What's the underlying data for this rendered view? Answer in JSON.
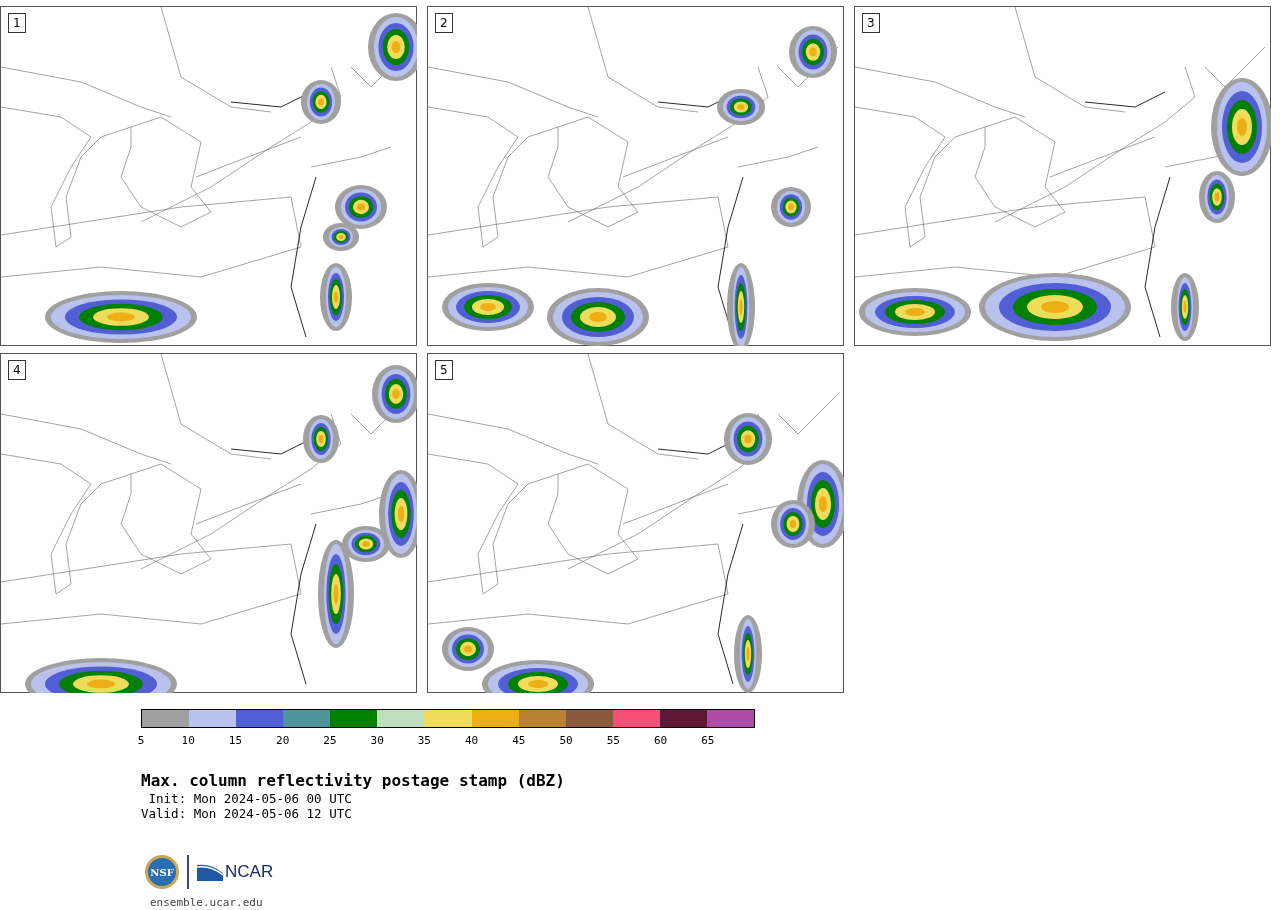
{
  "panels": [
    {
      "label": "1"
    },
    {
      "label": "2"
    },
    {
      "label": "3"
    },
    {
      "label": "4"
    },
    {
      "label": "5"
    }
  ],
  "colorbar": {
    "segments": [
      {
        "color": "#a0a0a0"
      },
      {
        "color": "#b8c2ec"
      },
      {
        "color": "#525ed4"
      },
      {
        "color": "#4e9599"
      },
      {
        "color": "#008000"
      },
      {
        "color": "#bfdfbf"
      },
      {
        "color": "#eedc5a"
      },
      {
        "color": "#eeae16"
      },
      {
        "color": "#b8822e"
      },
      {
        "color": "#8a5a3e"
      },
      {
        "color": "#f45078"
      },
      {
        "color": "#601838"
      },
      {
        "color": "#b04aa8"
      }
    ],
    "ticks": [
      "5",
      "10",
      "15",
      "20",
      "25",
      "30",
      "35",
      "40",
      "45",
      "50",
      "55",
      "60",
      "65"
    ]
  },
  "title": "Max. column reflectivity postage stamp (dBZ)",
  "init": " Init: Mon 2024-05-06 00 UTC",
  "valid": "Valid: Mon 2024-05-06 12 UTC",
  "logo": {
    "seal": "NSF",
    "name": "NCAR"
  },
  "url": "ensemble.ucar.edu"
}
